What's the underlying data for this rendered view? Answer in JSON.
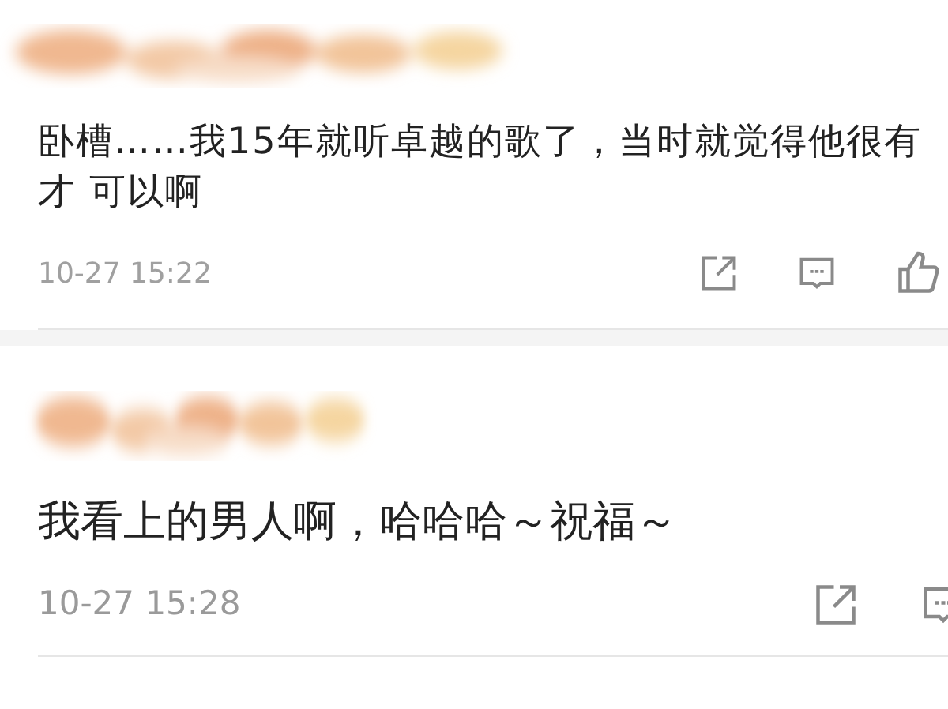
{
  "comments": [
    {
      "text": "卧槽……我15年就听卓越的歌了，当时就觉得他很有才 可以啊",
      "time": "10-27 15:22",
      "kind": "compact"
    },
    {
      "text": "我看上的男人啊，哈哈哈～祝福～",
      "time": "10-27 15:28",
      "kind": "large"
    }
  ]
}
